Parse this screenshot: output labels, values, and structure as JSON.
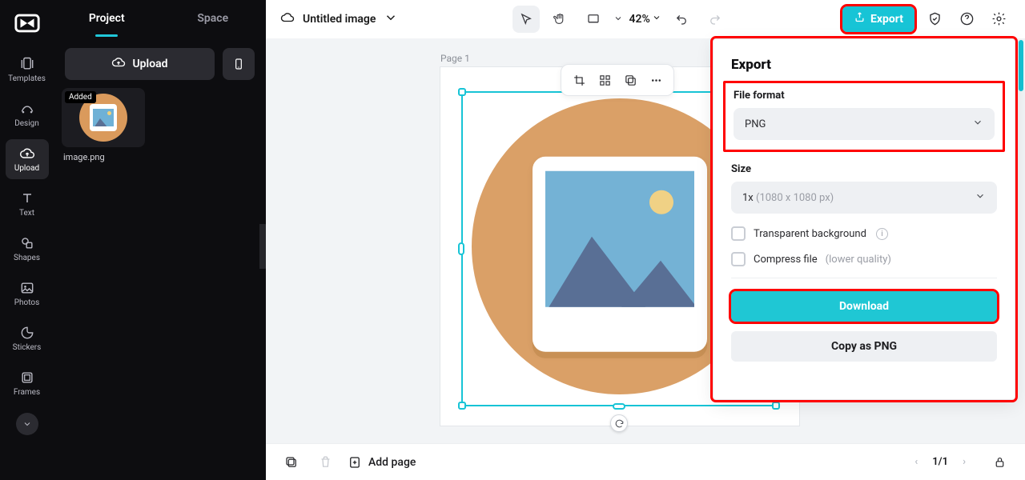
{
  "app": {
    "title": "Untitled image"
  },
  "leftbar": {
    "items": [
      {
        "key": "templates",
        "label": "Templates"
      },
      {
        "key": "design",
        "label": "Design"
      },
      {
        "key": "upload",
        "label": "Upload",
        "active": true
      },
      {
        "key": "text",
        "label": "Text"
      },
      {
        "key": "shapes",
        "label": "Shapes"
      },
      {
        "key": "photos",
        "label": "Photos"
      },
      {
        "key": "stickers",
        "label": "Stickers"
      },
      {
        "key": "frames",
        "label": "Frames"
      }
    ]
  },
  "panel": {
    "tabs": [
      {
        "label": "Project",
        "active": true
      },
      {
        "label": "Space",
        "active": false
      }
    ],
    "upload_label": "Upload",
    "asset": {
      "badge": "Added",
      "name": "image.png"
    }
  },
  "toolbar": {
    "zoom": "42%",
    "export_label": "Export"
  },
  "canvas": {
    "page_label": "Page 1"
  },
  "export_panel": {
    "title": "Export",
    "file_format_label": "File format",
    "file_format_value": "PNG",
    "size_label": "Size",
    "size_prefix": "1x",
    "size_dims": "(1080 x 1080 px)",
    "transparent_label": "Transparent background",
    "compress_label": "Compress file",
    "compress_note": "(lower quality)",
    "download_label": "Download",
    "copy_label": "Copy as PNG"
  },
  "bottom": {
    "addpage_label": "Add page",
    "page_indicator": "1/1"
  }
}
